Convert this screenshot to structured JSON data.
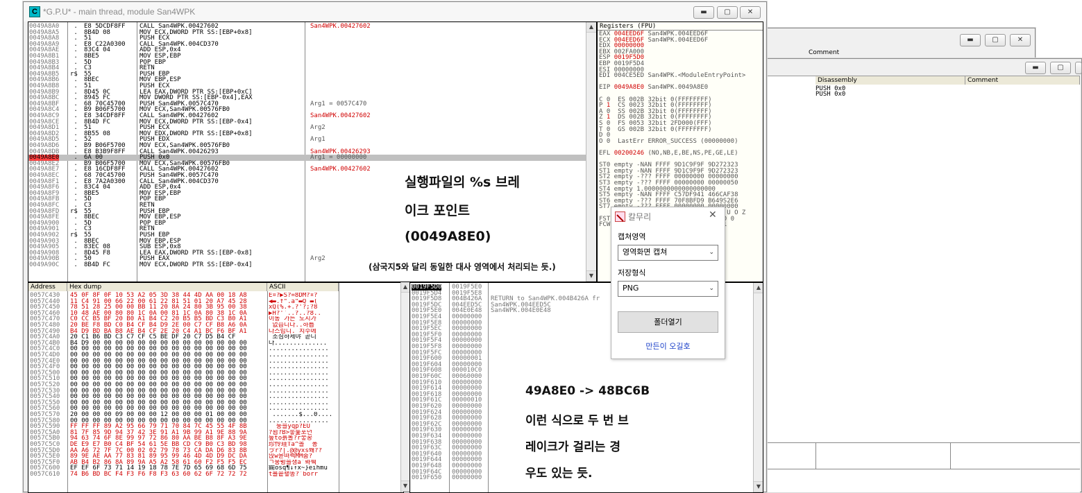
{
  "main_window": {
    "title": "*G.P.U* - main thread, module San4WPK",
    "icon_letter": "C"
  },
  "disasm": {
    "rows": [
      {
        "addr": "0049A8A0",
        "mark": " .",
        "hex": "E8 5DCDF8FF",
        "asm": "CALL San4WPK.00427602",
        "comment": "San4WPK.00427602"
      },
      {
        "addr": "0049A8A5",
        "mark": " .",
        "hex": "8B4D 08",
        "asm": "MOV ECX,DWORD PTR SS:[EBP+0x8]",
        "comment": ""
      },
      {
        "addr": "0049A8A8",
        "mark": " .",
        "hex": "51",
        "asm": "PUSH ECX",
        "comment": ""
      },
      {
        "addr": "0049A8A9",
        "mark": " .",
        "hex": "E8 C22A0300",
        "asm": "CALL San4WPK.004CD370",
        "comment": ""
      },
      {
        "addr": "0049A8AE",
        "mark": " .",
        "hex": "83C4 04",
        "asm": "ADD ESP,0x4",
        "comment": ""
      },
      {
        "addr": "0049A8B1",
        "mark": " .",
        "hex": "8BE5",
        "asm": "MOV ESP,EBP",
        "comment": ""
      },
      {
        "addr": "0049A8B3",
        "mark": " .",
        "hex": "5D",
        "asm": "POP EBP",
        "comment": ""
      },
      {
        "addr": "0049A8B4",
        "mark": " .",
        "hex": "C3",
        "asm": "RETN",
        "comment": ""
      },
      {
        "addr": "0049A8B5",
        "mark": "r$",
        "hex": "55",
        "asm": "PUSH EBP",
        "comment": ""
      },
      {
        "addr": "0049A8B6",
        "mark": " .",
        "hex": "8BEC",
        "asm": "MOV EBP,ESP",
        "comment": ""
      },
      {
        "addr": "0049A8B8",
        "mark": " .",
        "hex": "51",
        "asm": "PUSH ECX",
        "comment": ""
      },
      {
        "addr": "0049A8B9",
        "mark": " .",
        "hex": "8D45 0C",
        "asm": "LEA EAX,DWORD PTR SS:[EBP+0xC]",
        "comment": ""
      },
      {
        "addr": "0049A8BC",
        "mark": " .",
        "hex": "8945 FC",
        "asm": "MOV DWORD PTR SS:[EBP-0x4],EAX",
        "comment": ""
      },
      {
        "addr": "0049A8BF",
        "mark": " .",
        "hex": "68 70C45700",
        "asm": "PUSH San4WPK.0057C470",
        "comment": "Arg1 = 0057C470"
      },
      {
        "addr": "0049A8C4",
        "mark": " .",
        "hex": "B9 B06F5700",
        "asm": "MOV ECX,San4WPK.00576FB0",
        "comment": ""
      },
      {
        "addr": "0049A8C9",
        "mark": " .",
        "hex": "E8 34CDF8FF",
        "asm": "CALL San4WPK.00427602",
        "comment": "San4WPK.00427602"
      },
      {
        "addr": "0049A8CE",
        "mark": " .",
        "hex": "8B4D FC",
        "asm": "MOV ECX,DWORD PTR SS:[EBP-0x4]",
        "comment": ""
      },
      {
        "addr": "0049A8D1",
        "mark": " .",
        "hex": "51",
        "asm": "PUSH ECX",
        "comment": "Arg2"
      },
      {
        "addr": "0049A8D2",
        "mark": " .",
        "hex": "8B55 08",
        "asm": "MOV EDX,DWORD PTR SS:[EBP+0x8]",
        "comment": ""
      },
      {
        "addr": "0049A8D5",
        "mark": " .",
        "hex": "52",
        "asm": "PUSH EDX",
        "comment": "Arg1"
      },
      {
        "addr": "0049A8D6",
        "mark": " .",
        "hex": "B9 B06F5700",
        "asm": "MOV ECX,San4WPK.00576FB0",
        "comment": ""
      },
      {
        "addr": "0049A8DB",
        "mark": " .",
        "hex": "E8 B3B9F8FF",
        "asm": "CALL San4WPK.00426293",
        "comment": "San4WPK.00426293"
      },
      {
        "addr": "0049A8E0",
        "mark": " .",
        "hex": "6A 00",
        "asm": "PUSH 0x0",
        "comment": "Arg1 = 00000000"
      },
      {
        "addr": "0049A8E2",
        "mark": " .",
        "hex": "B9 B06F5700",
        "asm": "MOV ECX,San4WPK.00576FB0",
        "comment": ""
      },
      {
        "addr": "0049A8E7",
        "mark": " .",
        "hex": "E8 16CDF8FF",
        "asm": "CALL San4WPK.00427602",
        "comment": "San4WPK.00427602"
      },
      {
        "addr": "0049A8EC",
        "mark": " .",
        "hex": "68 70C45700",
        "asm": "PUSH San4WPK.0057C470",
        "comment": ""
      },
      {
        "addr": "0049A8F1",
        "mark": " .",
        "hex": "E8 7A2A0300",
        "asm": "CALL San4WPK.004CD370",
        "comment": ""
      },
      {
        "addr": "0049A8F6",
        "mark": " .",
        "hex": "83C4 04",
        "asm": "ADD ESP,0x4",
        "comment": ""
      },
      {
        "addr": "0049A8F9",
        "mark": " .",
        "hex": "8BE5",
        "asm": "MOV ESP,EBP",
        "comment": ""
      },
      {
        "addr": "0049A8FB",
        "mark": " .",
        "hex": "5D",
        "asm": "POP EBP",
        "comment": ""
      },
      {
        "addr": "0049A8FC",
        "mark": " .",
        "hex": "C3",
        "asm": "RETN",
        "comment": ""
      },
      {
        "addr": "0049A8FD",
        "mark": "r$",
        "hex": "55",
        "asm": "PUSH EBP",
        "comment": ""
      },
      {
        "addr": "0049A8FE",
        "mark": " .",
        "hex": "8BEC",
        "asm": "MOV EBP,ESP",
        "comment": ""
      },
      {
        "addr": "0049A900",
        "mark": " .",
        "hex": "5D",
        "asm": "POP EBP",
        "comment": ""
      },
      {
        "addr": "0049A901",
        "mark": " .",
        "hex": "C3",
        "asm": "RETN",
        "comment": ""
      },
      {
        "addr": "0049A902",
        "mark": "r$",
        "hex": "55",
        "asm": "PUSH EBP",
        "comment": ""
      },
      {
        "addr": "0049A903",
        "mark": " .",
        "hex": "8BEC",
        "asm": "MOV EBP,ESP",
        "comment": ""
      },
      {
        "addr": "0049A905",
        "mark": " .",
        "hex": "83EC 08",
        "asm": "SUB ESP,0x8",
        "comment": ""
      },
      {
        "addr": "0049A908",
        "mark": " .",
        "hex": "8D45 F8",
        "asm": "LEA EAX,DWORD PTR SS:[EBP-0x8]",
        "comment": ""
      },
      {
        "addr": "0049A90B",
        "mark": " .",
        "hex": "50",
        "asm": "PUSH EAX",
        "comment": "Arg2"
      },
      {
        "addr": "0049A90C",
        "mark": " .",
        "hex": "8B4D FC",
        "asm": "MOV ECX,DWORD PTR SS:[EBP-0x4]",
        "comment": ""
      }
    ],
    "highlight_addr": "0049A8E0"
  },
  "registers": {
    "header": "Registers (FPU)",
    "lines": [
      {
        "text": "EAX 004EED6F San4WPK.004EED6F",
        "red": true
      },
      {
        "text": "ECX 004EED6F San4WPK.004EED6F",
        "red": true
      },
      {
        "text": "EDX 00000000",
        "red": true
      },
      {
        "text": "EBX 002FA000",
        "red": false
      },
      {
        "text": "ESP 0019F5D0",
        "red": true
      },
      {
        "text": "EBP 0019F5D4",
        "red": false
      },
      {
        "text": "ESI 00000000",
        "red": false
      },
      {
        "text": "EDI 004CE5ED San4WPK.<ModuleEntryPoint>",
        "red": false
      },
      {
        "text": "",
        "red": false
      },
      {
        "text": "EIP 0049A8E0 San4WPK.0049A8E0",
        "red": true
      },
      {
        "text": "",
        "red": false
      },
      {
        "text": "C 0  ES 002B 32bit 0(FFFFFFFF)",
        "red": false
      },
      {
        "text": "P 1  CS 0023 32bit 0(FFFFFFFF)",
        "red": true
      },
      {
        "text": "A 0  SS 002B 32bit 0(FFFFFFFF)",
        "red": false
      },
      {
        "text": "Z 1  DS 002B 32bit 0(FFFFFFFF)",
        "red": true
      },
      {
        "text": "S 0  FS 0053 32bit 2FD000(FFF)",
        "red": false
      },
      {
        "text": "T 0  GS 002B 32bit 0(FFFFFFFF)",
        "red": false
      },
      {
        "text": "D 0",
        "red": false
      },
      {
        "text": "O 0  LastErr ERROR_SUCCESS (00000000)",
        "red": false
      },
      {
        "text": "",
        "red": false
      },
      {
        "text": "EFL 00200246 (NO,NB,E,BE,NS,PE,GE,LE)",
        "red": true
      },
      {
        "text": "",
        "red": false
      },
      {
        "text": "ST0 empty -NAN FFFF 9D1C9F9F 9D272323",
        "red": false
      },
      {
        "text": "ST1 empty -NAN FFFF 9D1C9F9F 9D272323",
        "red": false
      },
      {
        "text": "ST2 empty -??? FFFF 00000000 00000000",
        "red": false
      },
      {
        "text": "ST3 empty -??? FFFF 00000000 00000050",
        "red": false
      },
      {
        "text": "ST4 empty 1.0000000000000000000",
        "red": false
      },
      {
        "text": "ST5 empty -NAN FFFF C57DF941 466CAF38",
        "red": false
      },
      {
        "text": "ST6 empty -??? FFFF 70F8BFD9 B649S2E6",
        "red": false
      },
      {
        "text": "ST7 empty -??? FFFF 00000000 00000000",
        "red": false
      },
      {
        "text": "               3 2 1 0      E S P U O Z",
        "red": false
      },
      {
        "text": "FST                        0 1 0 0 0",
        "red": false
      },
      {
        "text": "FCW                        1 1 1 1",
        "red": false
      }
    ]
  },
  "annotations": {
    "break_title_1": "실행파일의 %s 브레",
    "break_title_2": "이크 포인트",
    "break_addr": "(0049A8E0)",
    "break_note": "(삼국지5와 달리 동일한 대사 영역에서 처리되는 듯.)",
    "second_1": "49A8E0 -> 48BC6B",
    "second_2": "이런 식으로 두 번 브",
    "second_3": "레이크가 걸리는 경",
    "second_4": "우도 있는 듯."
  },
  "dump": {
    "headers": {
      "address": "Address",
      "hex": "Hex dump",
      "ascii": "ASCII"
    },
    "rows": [
      {
        "addr": "0057C430",
        "hex": "45 0F 8F 0F 10 53 A2 05 3D 38 44 4D AA 00 18 A8",
        "ascii": "E¤?▶S?=8DM?¤?",
        "red": true
      },
      {
        "addr": "0057C440",
        "hex": "11 C4 91 00 66 22 00 61 22 81 51 01 20 A7 45 28",
        "ascii": "◀▬.f\".a\"▬Q ▬(",
        "red": true
      },
      {
        "addr": "0057C450",
        "hex": "78 51 28 25 00 00 BB 11 20 8A 24 80 3B 95 00 38",
        "ascii": "xQ(%.+.?'?;?8",
        "red": true
      },
      {
        "addr": "0057C460",
        "hex": "10 48 AE 00 80 80 1C 0A 00 81 1C 0A 80 38 1C 0A",
        "ascii": "▶H?'`..?..?8..",
        "red": true
      },
      {
        "addr": "0057C470",
        "hex": "C0 CC B5 BF 20 B0 A1 B4 C2 20 B5 B5 BD C3 B0 A1",
        "ascii": "이동 가는 도시가",
        "red": true
      },
      {
        "addr": "0057C480",
        "hex": "20 BE F8 BD C0 B4 CF B4 D9 2E 00 C7 CF B8 A6 0A",
        "ascii": " 없습니다..하릅",
        "red": true
      },
      {
        "addr": "0057C490",
        "hex": "B4 D9 BD BA B8 AE B4 CF 2E 20 C4 A1 BC F6 BF A1",
        "ascii": "다스립니. 치수에",
        "red": true
      },
      {
        "addr": "0057C4A0",
        "hex": "20 C1 B6 BD C3 C7 CF C5 BE DF 20 C7 D5 B4 CF",
        "ascii": " 조심하세야 곧니",
        "red": false
      },
      {
        "addr": "0057C4B0",
        "hex": "B4 D9 00 00 00 00 00 00 00 00 00 00 00 00 00 00",
        "ascii": "다..............",
        "red": false
      },
      {
        "addr": "0057C4C0",
        "hex": "00 00 00 00 00 00 00 00 00 00 00 00 00 00 00 00",
        "ascii": "................",
        "red": false
      },
      {
        "addr": "0057C4D0",
        "hex": "00 00 00 00 00 00 00 00 00 00 00 00 00 00 00 00",
        "ascii": "................",
        "red": false
      },
      {
        "addr": "0057C4E0",
        "hex": "00 00 00 00 00 00 00 00 00 00 00 00 00 00 00 00",
        "ascii": "................",
        "red": false
      },
      {
        "addr": "0057C4F0",
        "hex": "00 00 00 00 00 00 00 00 00 00 00 00 00 00 00 00",
        "ascii": "................",
        "red": false
      },
      {
        "addr": "0057C500",
        "hex": "00 00 00 00 00 00 00 00 00 00 00 00 00 00 00 00",
        "ascii": "................",
        "red": false
      },
      {
        "addr": "0057C510",
        "hex": "00 00 00 00 00 00 00 00 00 00 00 00 00 00 00 00",
        "ascii": "................",
        "red": false
      },
      {
        "addr": "0057C520",
        "hex": "00 00 00 00 00 00 00 00 00 00 00 00 00 00 00 00",
        "ascii": "................",
        "red": false
      },
      {
        "addr": "0057C530",
        "hex": "00 00 00 00 00 00 00 00 00 00 00 00 00 00 00 00",
        "ascii": "................",
        "red": false
      },
      {
        "addr": "0057C540",
        "hex": "00 00 00 00 00 00 00 00 00 00 00 00 00 00 00 00",
        "ascii": "................",
        "red": false
      },
      {
        "addr": "0057C550",
        "hex": "00 00 00 00 00 00 00 00 00 00 00 00 00 00 00 00",
        "ascii": "................",
        "red": false
      },
      {
        "addr": "0057C560",
        "hex": "00 00 00 00 00 00 00 00 00 00 00 00 00 00 00 00",
        "ascii": "................",
        "red": false
      },
      {
        "addr": "0057C570",
        "hex": "20 00 00 00 09 00 00 00 12 00 00 00 01 00 00 00",
        "ascii": " .......$...0....",
        "red": false
      },
      {
        "addr": "0057C580",
        "hex": "00 00 00 00 00 00 00 00 00 00 00 00 00 00 00 00",
        "ascii": "................",
        "red": false
      },
      {
        "addr": "0057C590",
        "hex": "FF FF FF 89 A2 95 66 79 71 70 84 7C 45 55 4F 8B",
        "ascii": "  둥블yqp?EU",
        "red": true
      },
      {
        "addr": "0057C5A0",
        "hex": "81 7F 85 9D 94 37 42 3E 91 A1 9B 99 A1 9E 88 9A",
        "ascii": "?꾐?B>둫둝포넌",
        "red": true
      },
      {
        "addr": "0057C5B0",
        "hex": "94 63 74 6F 8E 99 97 72 86 80 AA BE B8 8F A3 9E",
        "ascii": "둪to흙롤?r뭏꿍",
        "red": true
      },
      {
        "addr": "0057C5C0",
        "hex": "DE E9 E7 B0 C4 BF 54 61 5E BB CD C9 B0 C3 BD 98",
        "ascii": "珍怜珪Ta^볼  퐁",
        "red": true
      },
      {
        "addr": "0057C5D0",
        "hex": "AA A6 72 7F 7C 00 02 02 79 78 73 CA DA D6 83 8B",
        "ascii": "ゔr?|.@@yxs쐐??",
        "red": true
      },
      {
        "addr": "0057C5E0",
        "hex": "89 9E AE AA 77 83 81 89 95 99 46 4D 4D D9 DC DA",
        "ascii": "믽w윤뗘펙MM춤?",
        "red": true
      },
      {
        "addr": "0057C5F0",
        "hex": "AB B4 B2 86 8A 89 9A A5 A2 58 61 60 F2 F5 F5 EC",
        "ascii": "ㄱ뭉뜅솔챙a`롸훽",
        "red": true
      },
      {
        "addr": "0057C600",
        "hex": "EF EF 6F 73 71 14 19 18 78 7E 7D 65 69 68 6D 75",
        "ascii": "鍮osq¶↓↑x~}eihmu",
        "red": false
      },
      {
        "addr": "0057C610",
        "hex": "74 B6 BD BC F4 F3 F6 F8 F3 63 60 62 6F 72 72 72",
        "ascii": "t뵬솥쵛똥?`borr",
        "red": true
      }
    ]
  },
  "stack": {
    "rows": [
      {
        "addr": "0019F5D0",
        "val": "0019F5E0",
        "comment": "",
        "sel": true
      },
      {
        "addr": "0019F5D4",
        "val": "0019F5E8",
        "comment": "",
        "sel": false
      },
      {
        "addr": "0019F5D8",
        "val": "004B426A",
        "comment": "RETURN to San4WPK.004B426A fr",
        "sel": false
      },
      {
        "addr": "0019F5DC",
        "val": "004EED5C",
        "comment": "San4WPK.004EED5C",
        "sel": false
      },
      {
        "addr": "0019F5E0",
        "val": "004E0E48",
        "comment": "San4WPK.004E0E48",
        "sel": false
      },
      {
        "addr": "0019F5E4",
        "val": "00000000",
        "comment": "",
        "sel": false
      },
      {
        "addr": "0019F5E8",
        "val": "00000000",
        "comment": "",
        "sel": false
      },
      {
        "addr": "0019F5EC",
        "val": "00000000",
        "comment": "",
        "sel": false
      },
      {
        "addr": "0019F5F0",
        "val": "00000000",
        "comment": "",
        "sel": false
      },
      {
        "addr": "0019F5F4",
        "val": "00000000",
        "comment": "",
        "sel": false
      },
      {
        "addr": "0019F5F8",
        "val": "00000000",
        "comment": "",
        "sel": false
      },
      {
        "addr": "0019F5FC",
        "val": "00000000",
        "comment": "",
        "sel": false
      },
      {
        "addr": "0019F600",
        "val": "00000001",
        "comment": "",
        "sel": false
      },
      {
        "addr": "0019F604",
        "val": "00000000",
        "comment": "",
        "sel": false
      },
      {
        "addr": "0019F608",
        "val": "000010C0",
        "comment": "",
        "sel": false
      },
      {
        "addr": "0019F60C",
        "val": "00060000",
        "comment": "",
        "sel": false
      },
      {
        "addr": "0019F610",
        "val": "00000000",
        "comment": "",
        "sel": false
      },
      {
        "addr": "0019F614",
        "val": "00000000",
        "comment": "",
        "sel": false
      },
      {
        "addr": "0019F618",
        "val": "00000000",
        "comment": "",
        "sel": false
      },
      {
        "addr": "0019F61C",
        "val": "00000010",
        "comment": "",
        "sel": false
      },
      {
        "addr": "0019F620",
        "val": "00000000",
        "comment": "",
        "sel": false
      },
      {
        "addr": "0019F624",
        "val": "00000000",
        "comment": "",
        "sel": false
      },
      {
        "addr": "0019F628",
        "val": "00000000",
        "comment": "",
        "sel": false
      },
      {
        "addr": "0019F62C",
        "val": "00000000",
        "comment": "",
        "sel": false
      },
      {
        "addr": "0019F630",
        "val": "00000000",
        "comment": "",
        "sel": false
      },
      {
        "addr": "0019F634",
        "val": "00000000",
        "comment": "",
        "sel": false
      },
      {
        "addr": "0019F638",
        "val": "00000000",
        "comment": "",
        "sel": false
      },
      {
        "addr": "0019F63C",
        "val": "00000000",
        "comment": "",
        "sel": false
      },
      {
        "addr": "0019F640",
        "val": "00000000",
        "comment": "",
        "sel": false
      },
      {
        "addr": "0019F644",
        "val": "00000000",
        "comment": "",
        "sel": false
      },
      {
        "addr": "0019F648",
        "val": "00000000",
        "comment": "",
        "sel": false
      },
      {
        "addr": "0019F64C",
        "val": "00000000",
        "comment": "",
        "sel": false
      },
      {
        "addr": "0019F650",
        "val": "00000000",
        "comment": "",
        "sel": false
      }
    ]
  },
  "capture_dialog": {
    "title": "칼무리",
    "area_label": "캡쳐영역",
    "area_value": "영역화면 캡쳐",
    "format_label": "저장형식",
    "format_value": "PNG",
    "open_folder_button": "폴더열기",
    "credit_link": "만든이 오길호"
  },
  "back_window_1": {
    "comment_header": "Comment"
  },
  "back_window_2": {
    "disassembly_header": "Disassembly",
    "comment_header": "Comment",
    "rows": [
      "PUSH 0x0",
      "PUSH 0x0"
    ]
  },
  "colors": {
    "highlight_row": "#c0c0c0",
    "selected_addr": "#000000",
    "red_text": "#d00000",
    "scroll": "#e8e8e8"
  }
}
